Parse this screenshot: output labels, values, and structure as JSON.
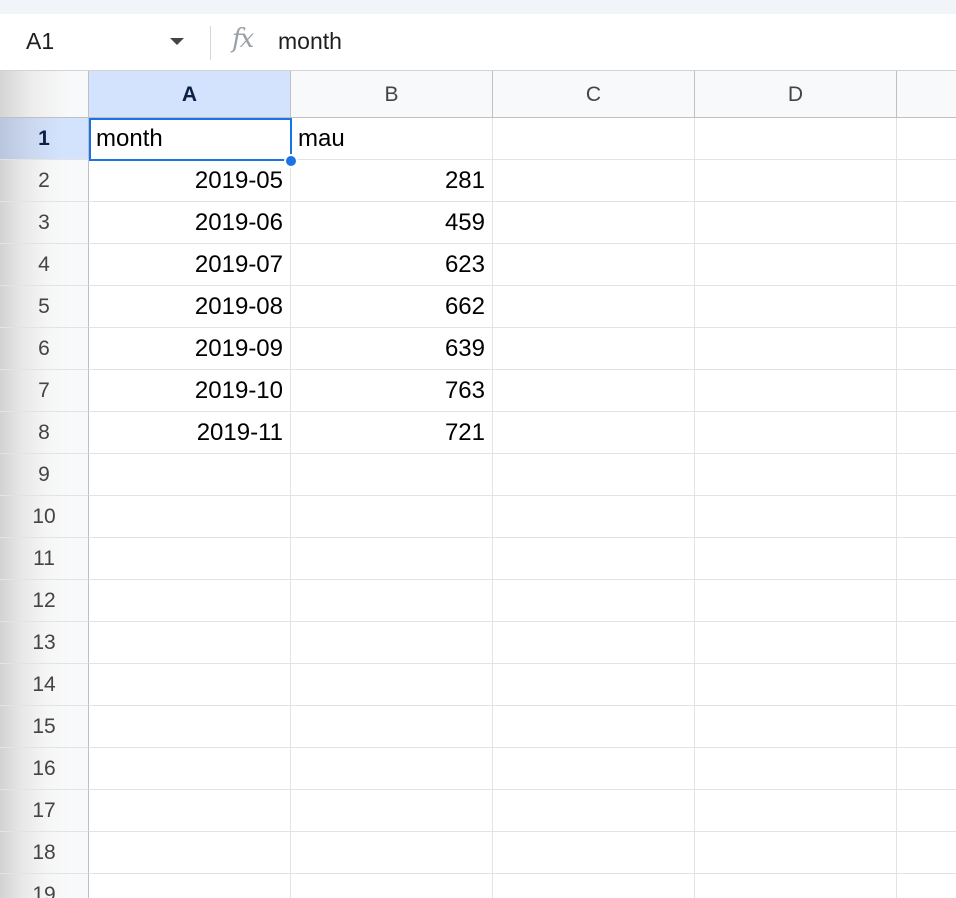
{
  "name_box": {
    "value": "A1"
  },
  "formula_bar": {
    "fx_label": "fx",
    "content": "month"
  },
  "columns": [
    "A",
    "B",
    "C",
    "D"
  ],
  "selected_column": "A",
  "row_numbers": [
    "1",
    "2",
    "3",
    "4",
    "5",
    "6",
    "7",
    "8",
    "9",
    "10",
    "11",
    "12",
    "13",
    "14",
    "15",
    "16",
    "17",
    "18",
    "19"
  ],
  "selected_row": "1",
  "active_cell": "A1",
  "cells": {
    "A1": "month",
    "B1": "mau",
    "A2": "2019-05",
    "B2": "281",
    "A3": "2019-06",
    "B3": "459",
    "A4": "2019-07",
    "B4": "623",
    "A5": "2019-08",
    "B5": "662",
    "A6": "2019-09",
    "B6": "639",
    "A7": "2019-10",
    "B7": "763",
    "A8": "2019-11",
    "B8": "721"
  },
  "colors": {
    "selection_accent": "#1a73e8",
    "selected_header_bg": "#d3e3fd"
  }
}
